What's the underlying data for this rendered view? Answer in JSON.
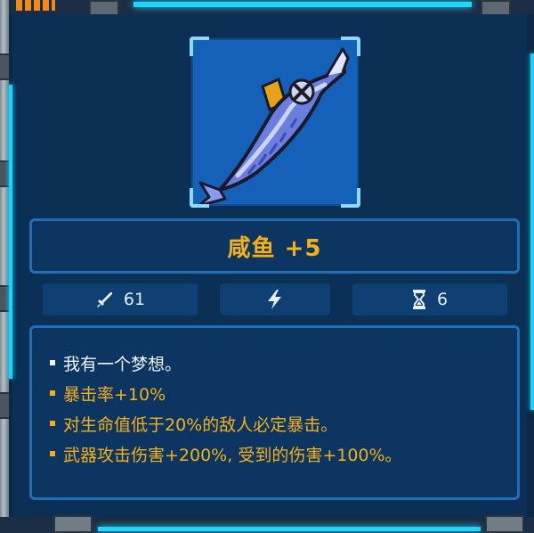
{
  "item": {
    "name": "咸鱼 +5",
    "icon": "salted-fish-weapon-icon"
  },
  "stats": {
    "damage_icon": "sword-icon",
    "damage": "61",
    "energy_icon": "lightning-icon",
    "energy": "",
    "cooldown_icon": "hourglass-icon",
    "cooldown": "6"
  },
  "description": [
    {
      "text": "我有一个梦想。",
      "color": "white"
    },
    {
      "text": "暴击率+10%",
      "color": "orange"
    },
    {
      "text": "对生命值低于20%的敌人必定暴击。",
      "color": "orange"
    },
    {
      "text": "武器攻击伤害+200%, 受到的伤害+100%。",
      "color": "orange"
    }
  ],
  "colors": {
    "accent_orange": "#f4b01a",
    "panel_blue": "#0d3561",
    "border_blue": "#1f6fb8",
    "neon_cyan": "#1fd6ff"
  }
}
